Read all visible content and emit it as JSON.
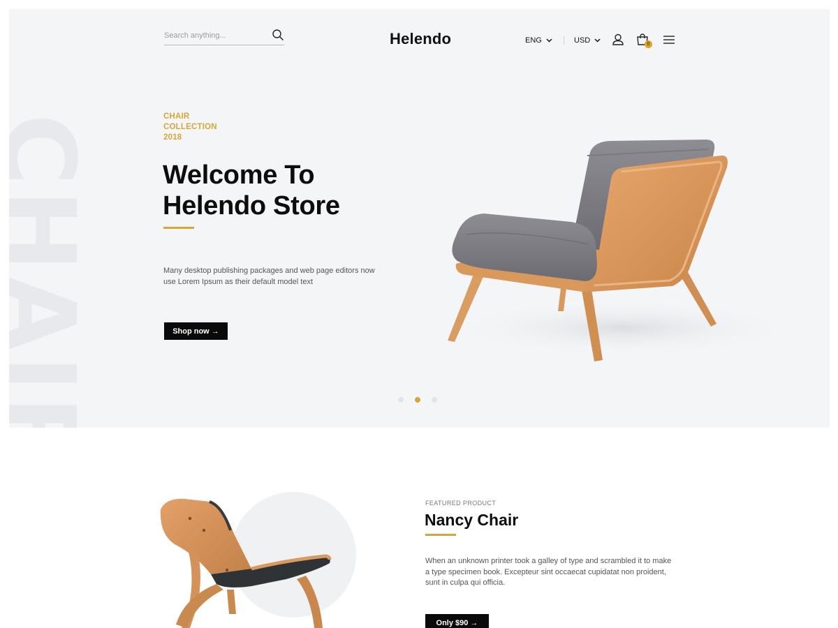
{
  "watermark": "CHAIR",
  "header": {
    "search_placeholder": "Search anything...",
    "logo": "Helendo",
    "language": "ENG",
    "currency": "USD",
    "cart_count": "0"
  },
  "hero": {
    "eyebrow": [
      "CHAIR",
      "COLLECTION",
      "2018"
    ],
    "title": [
      "Welcome To",
      "Helendo Store"
    ],
    "description": "Many desktop publishing packages and web page editors now use Lorem Ipsum as their default model text",
    "button": "Shop now →",
    "slides": {
      "count": 3,
      "active": 2
    }
  },
  "featured": {
    "eyebrow": "FEATURED PRODUCT",
    "title": "Nancy Chair",
    "description": "When an unknown printer took a galley of type and scrambled it to make a type specimen book. Excepteur sint occaecat cupidatat non proident, sunt in culpa qui officia.",
    "button": "Only $90 →"
  },
  "colors": {
    "accent": "#d7a63a",
    "hero_bg": "#f4f5f7",
    "button_bg": "#0a0a0a"
  },
  "icons": [
    "search-icon",
    "chevron-down-icon",
    "user-icon",
    "shopping-bag-icon",
    "menu-icon"
  ]
}
